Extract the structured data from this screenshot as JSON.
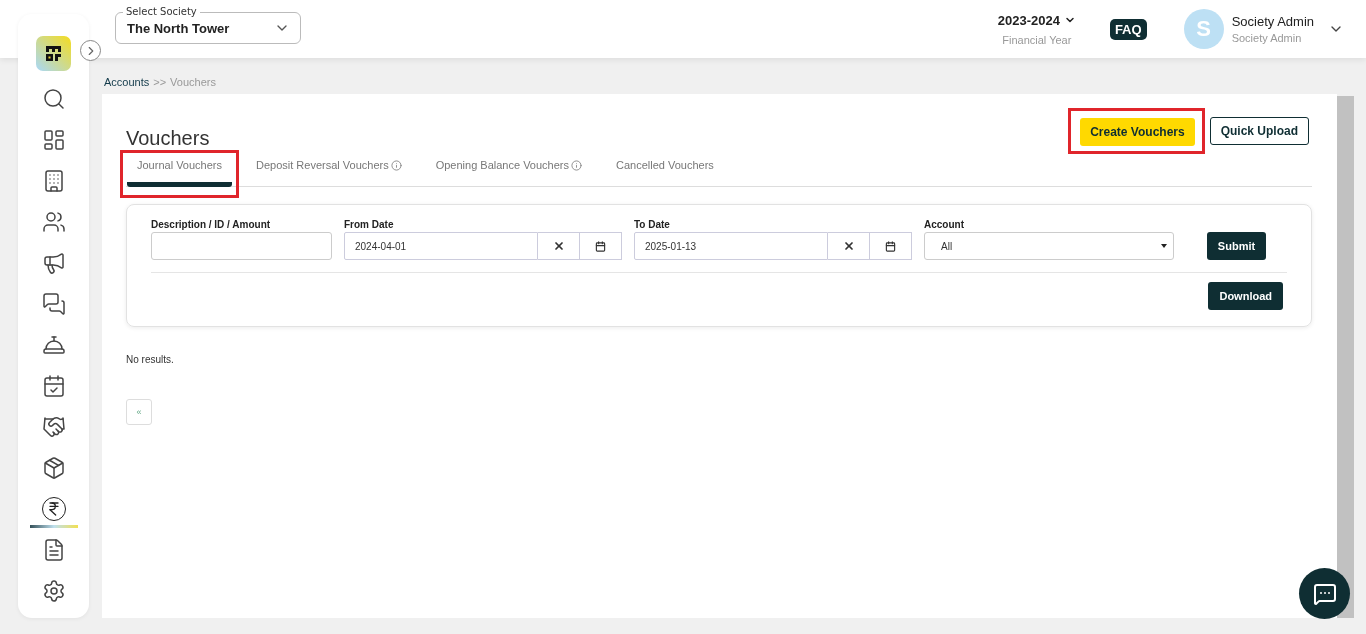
{
  "society_select": {
    "label": "Select Society",
    "value": "The North Tower"
  },
  "financial_year": {
    "value": "2023-2024",
    "label": "Financial Year"
  },
  "faq": "FAQ",
  "user": {
    "initial": "S",
    "name": "Society Admin",
    "role": "Society Admin"
  },
  "sidebar": {
    "items": [
      {
        "kind": "search",
        "selected": false
      },
      {
        "kind": "dashboard",
        "selected": false
      },
      {
        "kind": "building",
        "selected": false
      },
      {
        "kind": "people",
        "selected": false
      },
      {
        "kind": "megaphone",
        "selected": false
      },
      {
        "kind": "chat",
        "selected": false
      },
      {
        "kind": "desk",
        "selected": false
      },
      {
        "kind": "calendar",
        "selected": false
      },
      {
        "kind": "handshake",
        "selected": false
      },
      {
        "kind": "box",
        "selected": false
      },
      {
        "kind": "rupee",
        "selected": true
      },
      {
        "kind": "report",
        "selected": false
      },
      {
        "kind": "settings",
        "selected": false
      }
    ]
  },
  "breadcrumb": [
    {
      "label": "Accounts",
      "kind": "link"
    },
    {
      "label": ">>",
      "kind": "separator"
    },
    {
      "label": "Vouchers",
      "kind": "current"
    }
  ],
  "page_title": "Vouchers",
  "actions": [
    {
      "label": "Create Vouchers",
      "kind": "primary",
      "highlighted": true
    },
    {
      "label": "Quick Upload",
      "kind": "outline",
      "highlighted": false
    }
  ],
  "tabs": [
    {
      "label": "Journal Vouchers",
      "selected": true,
      "info": false,
      "highlighted": true
    },
    {
      "label": "Deposit Reversal Vouchers",
      "selected": false,
      "info": true,
      "highlighted": false
    },
    {
      "label": "Opening Balance Vouchers",
      "selected": false,
      "info": true,
      "highlighted": false
    },
    {
      "label": "Cancelled Vouchers",
      "selected": false,
      "info": false,
      "highlighted": false
    }
  ],
  "filters": {
    "search": {
      "label": "Description / ID / Amount"
    },
    "from_date": {
      "label": "From Date",
      "value": "2024-04-01"
    },
    "to_date": {
      "label": "To Date",
      "value": "2025-01-13"
    },
    "account": {
      "label": "Account",
      "value": "All"
    },
    "submit": "Submit",
    "download": "Download"
  },
  "empty_message": "No results.",
  "pagination": {
    "prev": "«"
  }
}
